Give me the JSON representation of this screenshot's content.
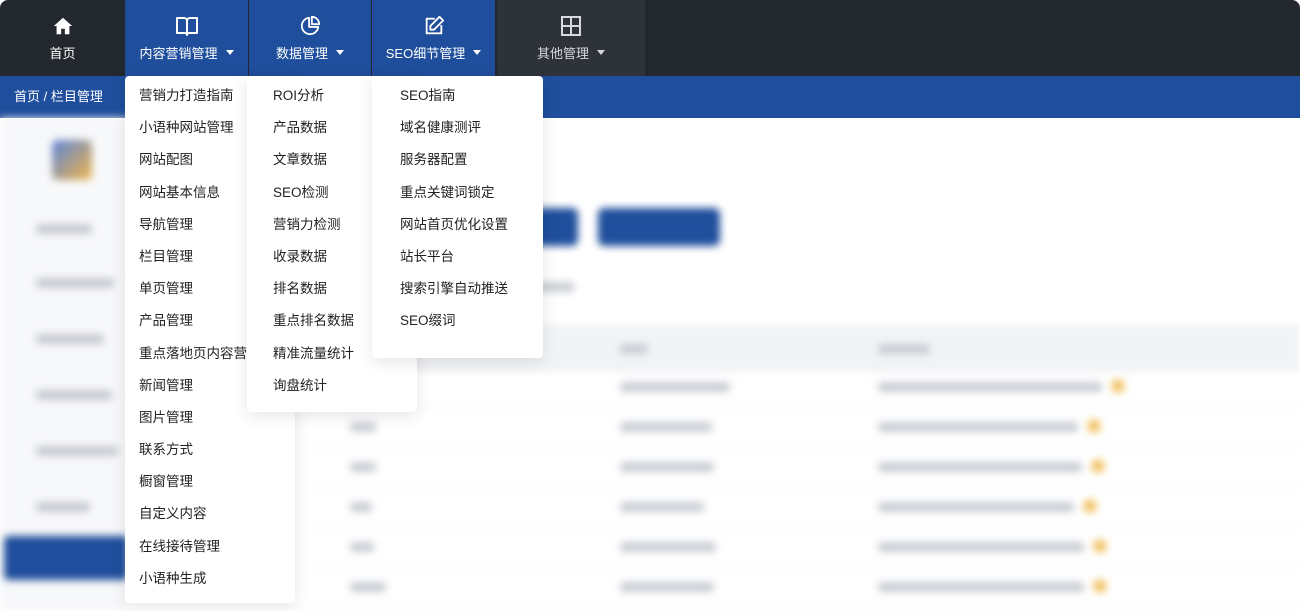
{
  "nav": {
    "items": [
      {
        "label": "首页",
        "icon": "home-icon",
        "has_caret": false
      },
      {
        "label": "内容营销管理",
        "icon": "book-icon",
        "has_caret": true
      },
      {
        "label": "数据管理",
        "icon": "pie-chart-icon",
        "has_caret": true
      },
      {
        "label": "SEO细节管理",
        "icon": "edit-icon",
        "has_caret": true
      },
      {
        "label": "其他管理",
        "icon": "grid-icon",
        "has_caret": true
      }
    ]
  },
  "breadcrumb": "首页 / 栏目管理",
  "menus": {
    "content_marketing": [
      "营销力打造指南",
      "小语种网站管理",
      "网站配图",
      "网站基本信息",
      "导航管理",
      "栏目管理",
      "单页管理",
      "产品管理",
      "重点落地页内容营销",
      "新闻管理",
      "图片管理",
      "联系方式",
      "橱窗管理",
      "自定义内容",
      "在线接待管理",
      "小语种生成"
    ],
    "data": [
      "ROI分析",
      "产品数据",
      "文章数据",
      "SEO检测",
      "营销力检测",
      "收录数据",
      "排名数据",
      "重点排名数据",
      "精准流量统计",
      "询盘统计"
    ],
    "seo": [
      "SEO指南",
      "域名健康测评",
      "服务器配置",
      "重点关键词锁定",
      "网站首页优化设置",
      "站长平台",
      "搜索引擎自动推送",
      "SEO缀词"
    ]
  },
  "colors": {
    "topbar": "#23272e",
    "accent": "#1f4e9c",
    "menu_bg": "#ffffff"
  }
}
